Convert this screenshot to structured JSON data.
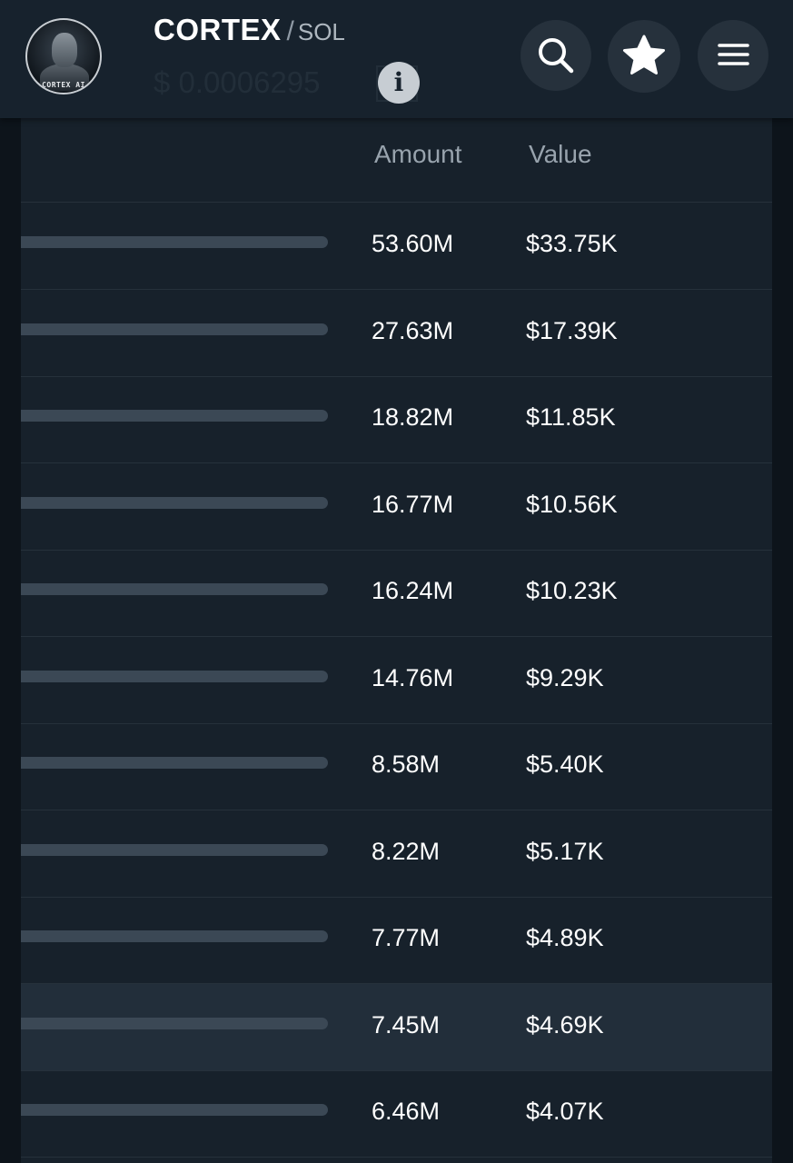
{
  "header": {
    "logo_text": "CORTEX AI",
    "title": "CORTEX",
    "separator": "/",
    "pair": "SOL",
    "price": "$ 0.0006295",
    "info_glyph": "i",
    "icons": [
      "search-icon",
      "star-icon",
      "menu-icon"
    ]
  },
  "table": {
    "columns": [
      "Amount",
      "Value"
    ],
    "rows": [
      {
        "amount": "53.60M",
        "value": "$33.75K"
      },
      {
        "amount": "27.63M",
        "value": "$17.39K"
      },
      {
        "amount": "18.82M",
        "value": "$11.85K"
      },
      {
        "amount": "16.77M",
        "value": "$10.56K"
      },
      {
        "amount": "16.24M",
        "value": "$10.23K"
      },
      {
        "amount": "14.76M",
        "value": "$9.29K"
      },
      {
        "amount": "8.58M",
        "value": "$5.40K"
      },
      {
        "amount": "8.22M",
        "value": "$5.17K"
      },
      {
        "amount": "7.77M",
        "value": "$4.89K"
      },
      {
        "amount": "7.45M",
        "value": "$4.69K"
      },
      {
        "amount": "6.46M",
        "value": "$4.07K"
      }
    ],
    "highlighted_row": 9
  },
  "colors": {
    "background": "#0d141b",
    "header": "#17222d",
    "panel": "#17212b",
    "highlight": "#222e3a",
    "text": "#ffffff",
    "muted": "#98a3ad"
  }
}
